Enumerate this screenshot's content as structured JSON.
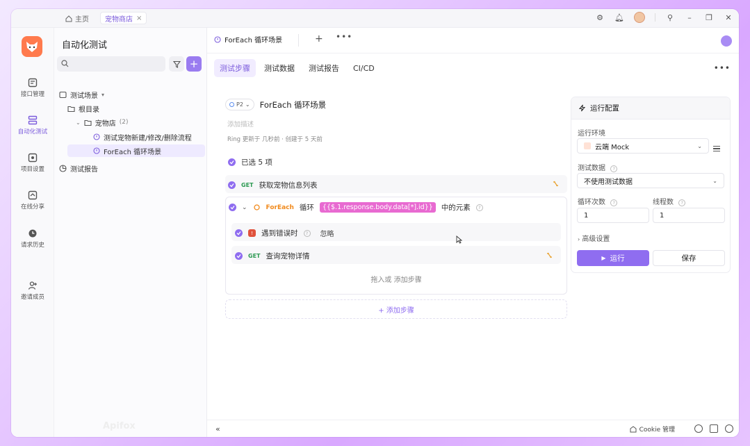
{
  "topbar": {
    "home_label": "主页",
    "shop_tab_label": "宠物商店",
    "close_glyph": "×"
  },
  "rail": {
    "items": [
      {
        "label": "接口管理",
        "icon": "api-icon"
      },
      {
        "label": "自动化测试",
        "icon": "automation-icon"
      },
      {
        "label": "项目设置",
        "icon": "settings-icon"
      },
      {
        "label": "在线分享",
        "icon": "share-icon"
      },
      {
        "label": "请求历史",
        "icon": "history-icon"
      },
      {
        "label": "邀请成员",
        "icon": "invite-icon"
      }
    ]
  },
  "tree": {
    "title": "自动化测试",
    "section_scenarios": "测试场景",
    "root_dir": "根目录",
    "folder_name": "宠物店",
    "folder_count": "(2)",
    "case1": "测试宠物新建/修改/删除流程",
    "case2": "ForEach 循环场景",
    "section_reports": "测试报告"
  },
  "doc_tab": {
    "title": "ForEach 循环场景",
    "plus": "+",
    "more": "•••"
  },
  "sub_tabs": [
    "测试步骤",
    "测试数据",
    "测试报告",
    "CI/CD"
  ],
  "case": {
    "priority": "P2",
    "title": "ForEach 循环场景",
    "add_desc": "添加描述",
    "meta": "Ring 更新于 几秒前 · 创建于 5 天前"
  },
  "steps": {
    "selected": "已选 5 项",
    "step1_method": "GET",
    "step1_name": "获取宠物信息列表",
    "foreach_kw": "ForEach",
    "loop_label": "循环",
    "expr": "{{$.1.response.body.data[*].id}}",
    "element_label": "中的元素",
    "wait_label": "遇到错误时",
    "wait_value": "忽略",
    "step2_method": "GET",
    "step2_name": "查询宠物详情",
    "insert_hint": "拖入或 添加步骤",
    "add_step": "+ 添加步骤"
  },
  "run_config": {
    "title": "运行配置",
    "env_label": "运行环境",
    "env_value": "云端 Mock",
    "data_label": "测试数据",
    "data_value": "不使用测试数据",
    "loop_label": "循环次数",
    "loop_value": "1",
    "thread_label": "线程数",
    "thread_value": "1",
    "advanced": "高级设置",
    "run": "运行",
    "save": "保存"
  },
  "bottom": {
    "collapse": "«",
    "cookie": "Cookie 管理"
  },
  "watermark": "Apifox"
}
